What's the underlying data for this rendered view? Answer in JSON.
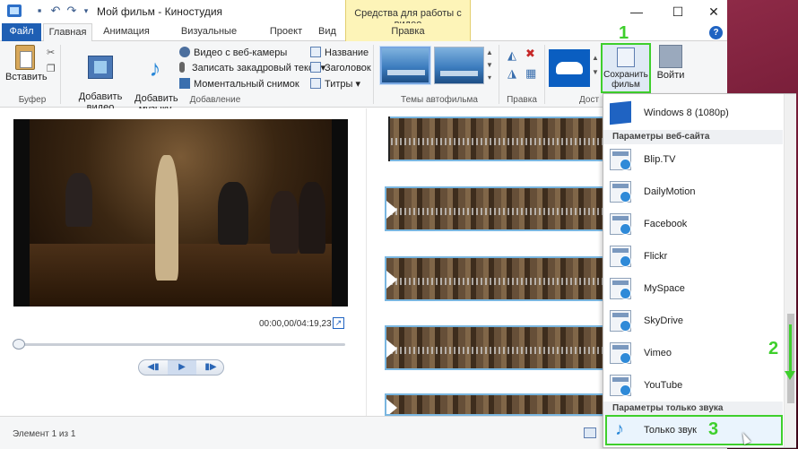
{
  "window": {
    "title": "Мой фильм - Киностудия",
    "context_header": "Средства для работы с видео",
    "minimize": "—",
    "maximize": "☐",
    "close": "✕"
  },
  "tabs": [
    {
      "label": "Файл"
    },
    {
      "label": "Главная"
    },
    {
      "label": "Анимация"
    },
    {
      "label": "Визуальные эффекты"
    },
    {
      "label": "Проект"
    },
    {
      "label": "Вид"
    },
    {
      "label": "Правка"
    }
  ],
  "ribbon": {
    "paste": "Вставить",
    "add_video": "Добавить видео\nи фотографии",
    "add_music": "Добавить\nмузыку",
    "webcam": "Видео с веб-камеры",
    "voiceover": "Записать закадровый текст",
    "snapshot": "Моментальный снимок",
    "title": "Название",
    "caption": "Заголовок",
    "credits": "Титры",
    "save_movie": "Сохранить\nфильм",
    "sign_in": "Войти",
    "groups": {
      "clipboard": "Буфер",
      "add": "Добавление",
      "themes": "Темы автофильма",
      "edit": "Правка",
      "share": "Дост"
    }
  },
  "preview": {
    "time": "00:00,00/04:19,23",
    "seek_position": 0.0
  },
  "dropdown": {
    "windows8": "Windows 8 (1080p)",
    "web_header": "Параметры веб-сайта",
    "sites": [
      "Blip.TV",
      "DailyMotion",
      "Facebook",
      "Flickr",
      "MySpace",
      "SkyDrive",
      "Vimeo",
      "YouTube"
    ],
    "audio_header": "Параметры только звука",
    "audio_only": "Только звук"
  },
  "status": {
    "text": "Элемент 1 из 1"
  },
  "annotations": {
    "step1": "1",
    "step2": "2",
    "step3": "3",
    "color": "#3ecf2c"
  }
}
